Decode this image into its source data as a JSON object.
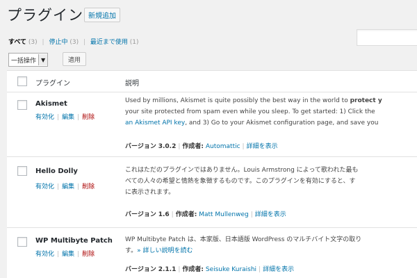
{
  "header": {
    "title": "プラグイン",
    "add_new": "新規追加"
  },
  "filters": {
    "all_label": "すべて",
    "all_count": "(3)",
    "inactive_label": "停止中",
    "inactive_count": "(3)",
    "recent_label": "最近まで使用",
    "recent_count": "(1)"
  },
  "bulk": {
    "selected": "一括操作",
    "apply": "適用"
  },
  "table": {
    "col_plugin": "プラグイン",
    "col_description": "説明"
  },
  "plugins": [
    {
      "name": "Akismet",
      "activate": "有効化",
      "edit": "編集",
      "delete": "削除",
      "desc_line1_pre": "Used by millions, Akismet is quite possibly the best way in the world to ",
      "desc_line1_bold": "protect y",
      "desc_line2": "your site protected from spam even while you sleep. To get started: 1) Click the",
      "desc_line3_link": "an Akismet API key",
      "desc_line3_rest": ", and 3) Go to your Akismet configuration page, and save you",
      "version_label": "バージョン",
      "version": "3.0.2",
      "author_label": "作成者:",
      "author": "Automattic",
      "details": "詳細を表示"
    },
    {
      "name": "Hello Dolly",
      "activate": "有効化",
      "edit": "編集",
      "delete": "削除",
      "desc_line1": "これはただのプラグインではありません。Louis Armstrong によって歌われた最も",
      "desc_line2": "べての人々の希望と情熱を象徴するものです。このプラグインを有効にすると、す",
      "desc_line3": "に表示されます。",
      "version_label": "バージョン",
      "version": "1.6",
      "author_label": "作成者:",
      "author": "Matt Mullenweg",
      "details": "詳細を表示"
    },
    {
      "name": "WP Multibyte Patch",
      "activate": "有効化",
      "edit": "編集",
      "delete": "削除",
      "desc_line1": "WP Multibyte Patch は、本家版、日本語版 WordPress のマルチバイト文字の取り",
      "desc_line2_pre": "す。",
      "desc_line2_link": "» 詳しい説明を読む",
      "version_label": "バージョン",
      "version": "2.1.1",
      "author_label": "作成者:",
      "author": "Seisuke Kuraishi",
      "details": "詳細を表示"
    }
  ]
}
